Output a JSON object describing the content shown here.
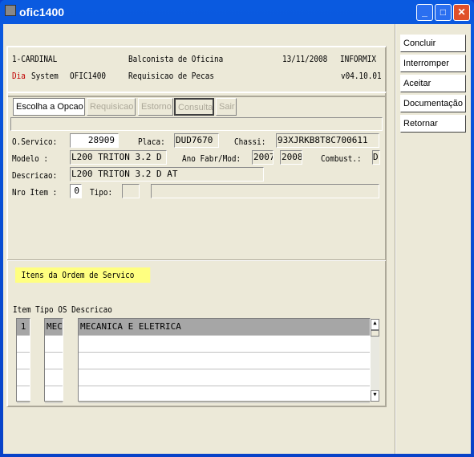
{
  "window": {
    "title": "ofic1400",
    "icon": "computer-icon"
  },
  "side_buttons": [
    "Concluir",
    "Interromper",
    "Aceitar",
    "Documentação",
    "Retornar"
  ],
  "header": {
    "company": "1-CARDINAL",
    "role": "Balconista de Oficina",
    "date": "13/11/2008",
    "db": "INFORMIX",
    "brand_red": "Dia",
    "brand_rest": "System",
    "program": "OFIC1400",
    "screen": "Requisicao de Pecas",
    "version": "v04.10.01",
    "brand_color": "#c00000"
  },
  "tabs": [
    "Escolha a Opcao",
    "Requisicao",
    "Estorno",
    "Consulta",
    "Sair"
  ],
  "form": {
    "os_label": "O.Servico:",
    "os_value": "28909",
    "placa_label": "Placa:",
    "placa_value": "DUD7670",
    "chassi_label": "Chassi:",
    "chassi_value": "93XJRKB8T8C700611",
    "modelo_label": "Modelo   :",
    "modelo_value": "L200 TRITON 3.2 D",
    "ano_label": "Ano Fabr/Mod:",
    "ano_fabr": "2007",
    "ano_mod": "2008",
    "comb_label": "Combust.:",
    "comb_value": "D",
    "desc_label": "Descricao:",
    "desc_value": "L200 TRITON 3.2 D AT",
    "item_label": "Nro Item :",
    "item_value": "0",
    "tipo_label": "Tipo:",
    "tipo_value": "",
    "tipo_desc": ""
  },
  "items": {
    "title": "Itens da Ordem de Servico",
    "title_bg": "#ffff80",
    "header": "Item Tipo OS Descricao",
    "rows": [
      {
        "item": "1",
        "tipo": "MEC",
        "desc": "MECANICA E ELETRICA"
      },
      {
        "item": "",
        "tipo": "",
        "desc": ""
      },
      {
        "item": "",
        "tipo": "",
        "desc": ""
      },
      {
        "item": "",
        "tipo": "",
        "desc": ""
      },
      {
        "item": "",
        "tipo": "",
        "desc": ""
      }
    ]
  }
}
